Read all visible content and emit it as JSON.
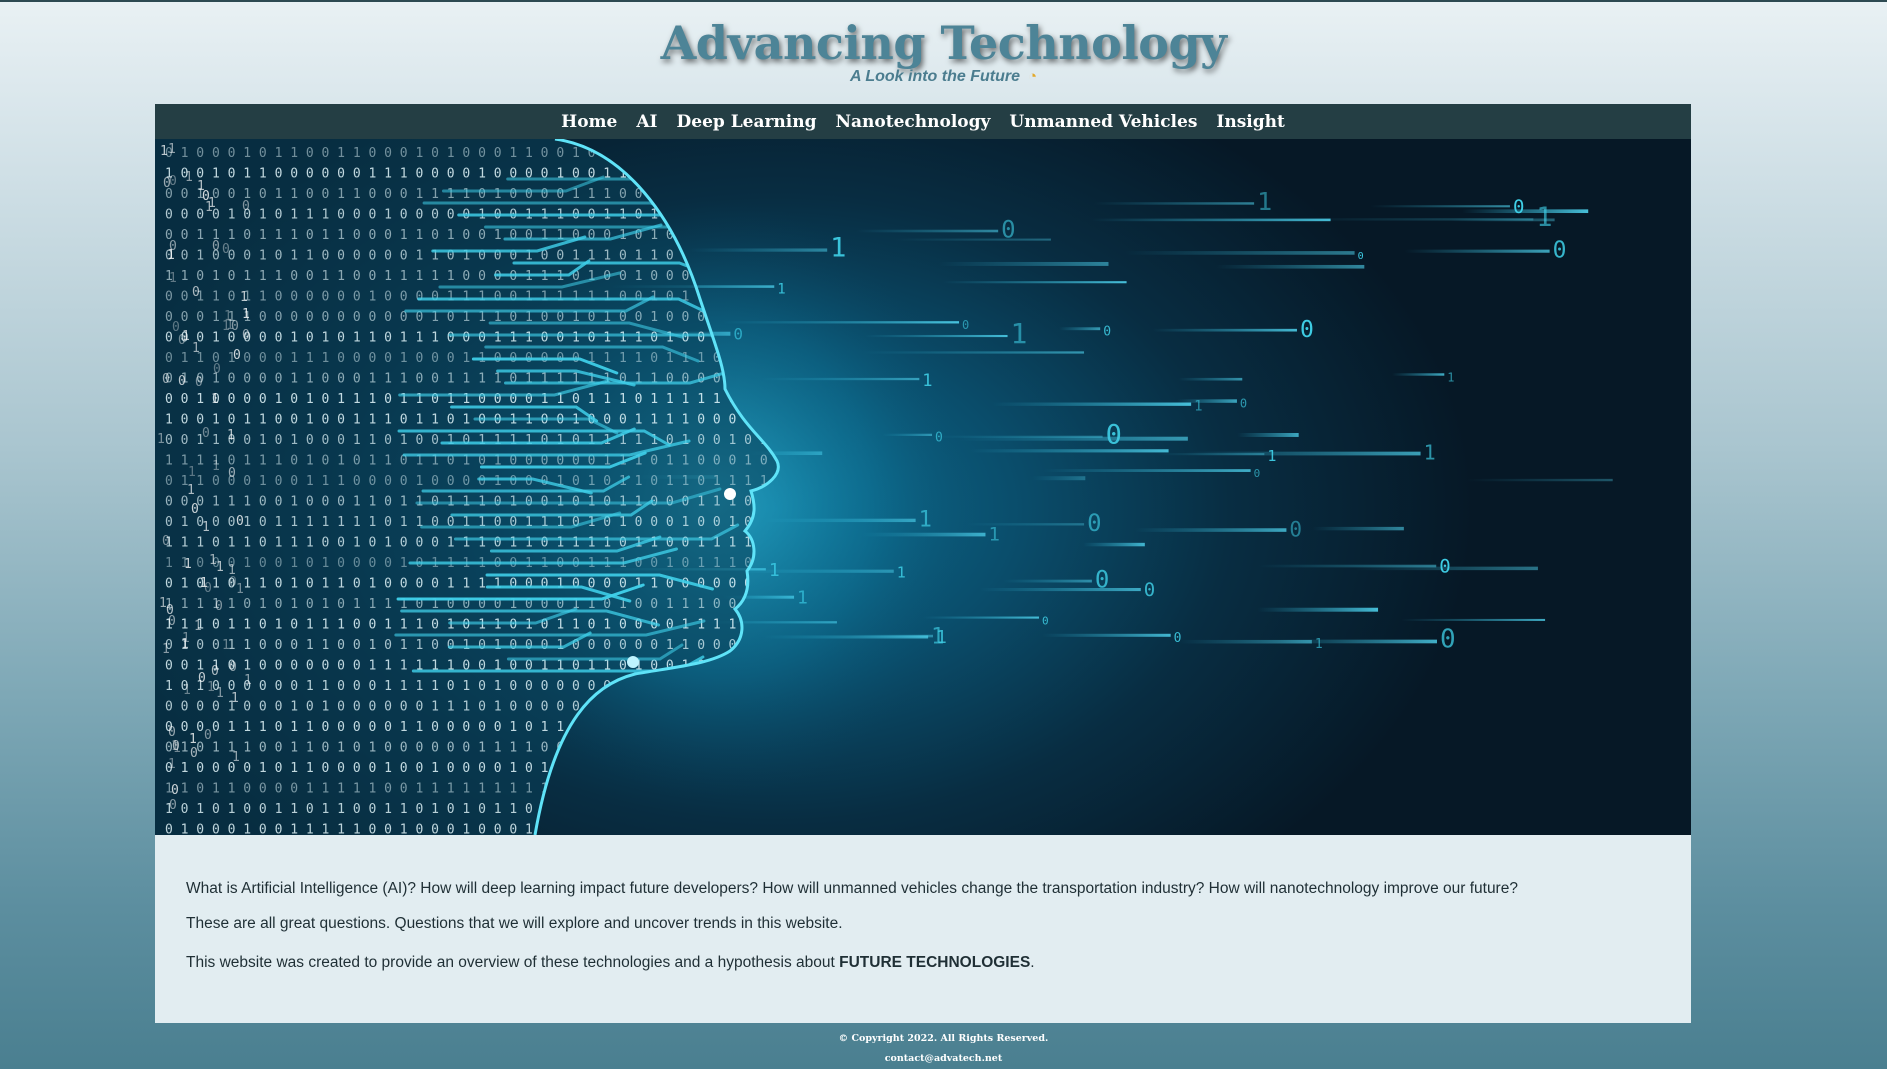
{
  "header": {
    "title": "Advancing Technology",
    "tagline": "A Look into the Future",
    "tagline_icon": "spinner-icon"
  },
  "nav": {
    "items": [
      "Home",
      "AI",
      "Deep Learning",
      "Nanotechnology",
      "Unmanned Vehicles",
      "Insight"
    ]
  },
  "hero": {
    "image_subject": "ai-head-circuit-image"
  },
  "content": {
    "paragraph1": "What is Artificial Intelligence (AI)? How will deep learning impact future developers? How will unmanned vehicles change the transportation industry? How will nanotechnology improve our future?",
    "paragraph2": "These are all great questions. Questions that we will explore and uncover trends in this website.",
    "paragraph3_prefix": "This website was created to provide an overview of these technologies and a hypothesis about ",
    "paragraph3_strong": "FUTURE TECHNOLOGIES",
    "paragraph3_suffix": "."
  },
  "footer": {
    "copyright": "© Copyright 2022. All Rights Reserved.",
    "contact": "contact@advatech.net"
  },
  "colors": {
    "title": "#4d8497",
    "nav_bg": "#243e44",
    "hero_glow": "#0d6f93",
    "circuit": "#33c3dc",
    "content_bg": "#e2edf1",
    "tagline_icon": "#e3a92a"
  }
}
